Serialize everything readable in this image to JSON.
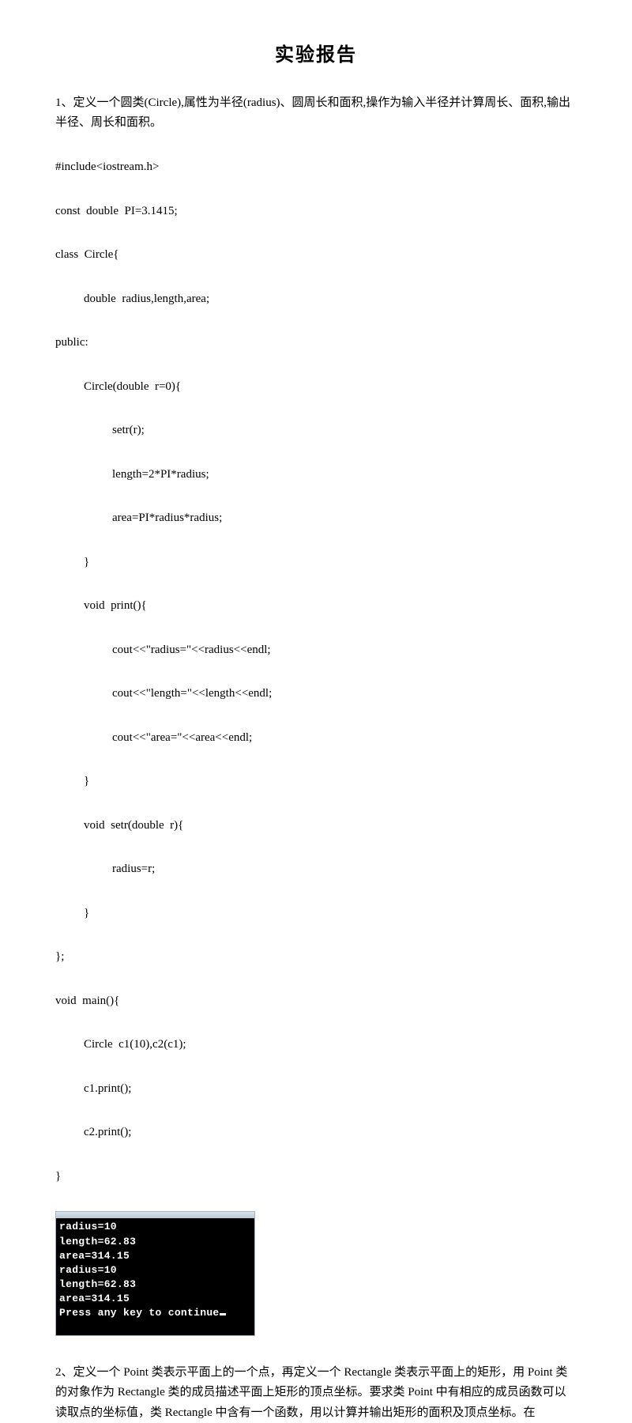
{
  "title": "实验报告",
  "problem1": "1、定义一个圆类(Circle),属性为半径(radius)、圆周长和面积,操作为输入半径并计算周长、面积,输出半径、周长和面积。",
  "code1": {
    "l01": "#include<iostream.h>",
    "l02": "const  double  PI=3.1415;",
    "l03": "class  Circle{",
    "l04": "double  radius,length,area;",
    "l05": "public:",
    "l06": "Circle(double  r=0){",
    "l07": "setr(r);",
    "l08": "length=2*PI*radius;",
    "l09": "area=PI*radius*radius;",
    "l10": "}",
    "l11": "void  print(){",
    "l12": "cout<<\"radius=\"<<radius<<endl;",
    "l13": "cout<<\"length=\"<<length<<endl;",
    "l14": "cout<<\"area=\"<<area<<endl;",
    "l15": "}",
    "l16": "void  setr(double  r){",
    "l17": "radius=r;",
    "l18": "}",
    "l19": "};",
    "l20": "void  main(){",
    "l21": "Circle  c1(10),c2(c1);",
    "l22": "c1.print();",
    "l23": "c2.print();",
    "l24": "}"
  },
  "console1": {
    "l1": "radius=10",
    "l2": "length=62.83",
    "l3": "area=314.15",
    "l4": "radius=10",
    "l5": "length=62.83",
    "l6": "area=314.15",
    "l7": "Press any key to continue"
  },
  "problem2": "2、定义一个 Point 类表示平面上的一个点，再定义一个 Rectangle 类表示平面上的矩形，用 Point 类的对象作为 Rectangle 类的成员描述平面上矩形的顶点坐标。要求类 Point 中有相应的成员函数可以读取点的坐标值，类 Rectangle 中含有一个函数，用以计算并输出矩形的面积及顶点坐标。在"
}
